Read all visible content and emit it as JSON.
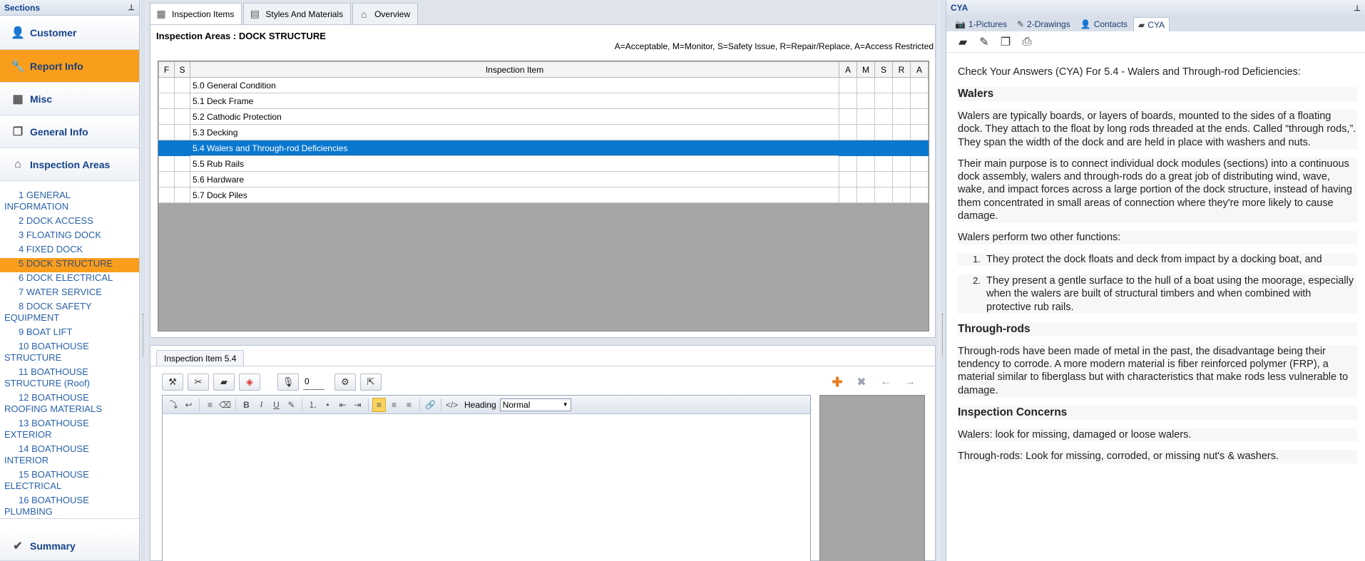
{
  "left_pane": {
    "title": "Sections",
    "sections": [
      {
        "label": "Customer",
        "icon": "person-icon"
      },
      {
        "label": "Report Info",
        "icon": "wrench-icon"
      },
      {
        "label": "Misc",
        "icon": "calculator-icon"
      },
      {
        "label": "General Info",
        "icon": "documents-icon"
      },
      {
        "label": "Inspection Areas",
        "icon": "house-icon"
      }
    ],
    "areas": [
      {
        "num": "1",
        "label": "GENERAL INFORMATION"
      },
      {
        "num": "2",
        "label": "DOCK ACCESS"
      },
      {
        "num": "3",
        "label": "FLOATING DOCK"
      },
      {
        "num": "4",
        "label": "FIXED DOCK"
      },
      {
        "num": "5",
        "label": "DOCK STRUCTURE"
      },
      {
        "num": "6",
        "label": "DOCK ELECTRICAL"
      },
      {
        "num": "7",
        "label": "WATER SERVICE"
      },
      {
        "num": "8",
        "label": "DOCK SAFETY EQUIPMENT"
      },
      {
        "num": "9",
        "label": "BOAT LIFT"
      },
      {
        "num": "10",
        "label": "BOATHOUSE STRUCTURE"
      },
      {
        "num": "11",
        "label": "BOATHOUSE STRUCTURE (Roof)"
      },
      {
        "num": "12",
        "label": "BOATHOUSE ROOFING MATERIALS"
      },
      {
        "num": "13",
        "label": "BOATHOUSE EXTERIOR"
      },
      {
        "num": "14",
        "label": "BOATHOUSE INTERIOR"
      },
      {
        "num": "15",
        "label": "BOATHOUSE ELECTRICAL"
      },
      {
        "num": "16",
        "label": "BOATHOUSE PLUMBING"
      }
    ],
    "summary_label": "Summary"
  },
  "center": {
    "tabs": [
      {
        "label": "Inspection Items",
        "icon": "grid-icon"
      },
      {
        "label": "Styles And Materials",
        "icon": "table-icon"
      },
      {
        "label": "Overview",
        "icon": "house-icon"
      }
    ],
    "area_title": "Inspection Areas : DOCK STRUCTURE",
    "legend": "A=Acceptable, M=Monitor, S=Safety Issue, R=Repair/Replace, A=Access Restricted",
    "columns": [
      "F",
      "S",
      "Inspection Item",
      "A",
      "M",
      "S",
      "R",
      "A"
    ],
    "items": [
      "5.0 General Condition",
      "5.1 Deck Frame",
      "5.2 Cathodic Protection",
      "5.3 Decking",
      "5.4 Walers and Through-rod Deficiencies",
      "5.5 Rub Rails",
      "5.6 Hardware",
      "5.7 Dock Piles"
    ],
    "lower_tab": "Inspection Item 5.4",
    "count": "0",
    "heading_label": "Heading",
    "heading_value": "Normal"
  },
  "right_pane": {
    "title": "CYA",
    "tabs": [
      {
        "label": "1-Pictures",
        "icon": "camera-icon"
      },
      {
        "label": "2-Drawings",
        "icon": "pencil-icon"
      },
      {
        "label": "Contacts",
        "icon": "person-icon"
      },
      {
        "label": "CYA",
        "icon": "book-icon"
      }
    ],
    "intro": "Check Your Answers (CYA) For 5.4 - Walers and Through-rod Deficiencies:",
    "h_walers": "Walers",
    "p1": "Walers are typically boards, or layers of boards, mounted to the sides of a floating dock. They attach to the float by long rods threaded at the ends. Called “through rods,”. They span the width of the dock and are held in place with washers and nuts.",
    "p2": "Their main purpose is to connect individual dock modules (sections) into a continuous dock assembly, walers and through-rods do a great job of distributing wind, wave, wake, and impact forces across a large portion of the dock structure, instead of having them concentrated in small areas of connection where they're more likely to cause damage.",
    "p3": "Walers perform two other functions:",
    "list": [
      "They protect the dock floats and deck from impact by a docking boat, and",
      "They present a gentle surface to the hull of a boat using the moorage, especially when the walers are built of structural timbers and when combined with protective rub rails."
    ],
    "h_rods": "Through-rods",
    "p4": "Through-rods have been made of metal in the past, the disadvantage being their tendency to corrode. A more modern material is fiber reinforced polymer (FRP), a material similar to fiberglass but with characteristics that make rods less vulnerable to damage.",
    "h_concerns": "Inspection Concerns",
    "p5": "Walers: look for missing, damaged or loose walers.",
    "p6": "Through-rods: Look for missing, corroded, or missing nut's & washers."
  },
  "colors": {
    "accent_orange": "#f99d1c",
    "selection_blue": "#0b78d0",
    "link_blue": "#2a62a8"
  }
}
